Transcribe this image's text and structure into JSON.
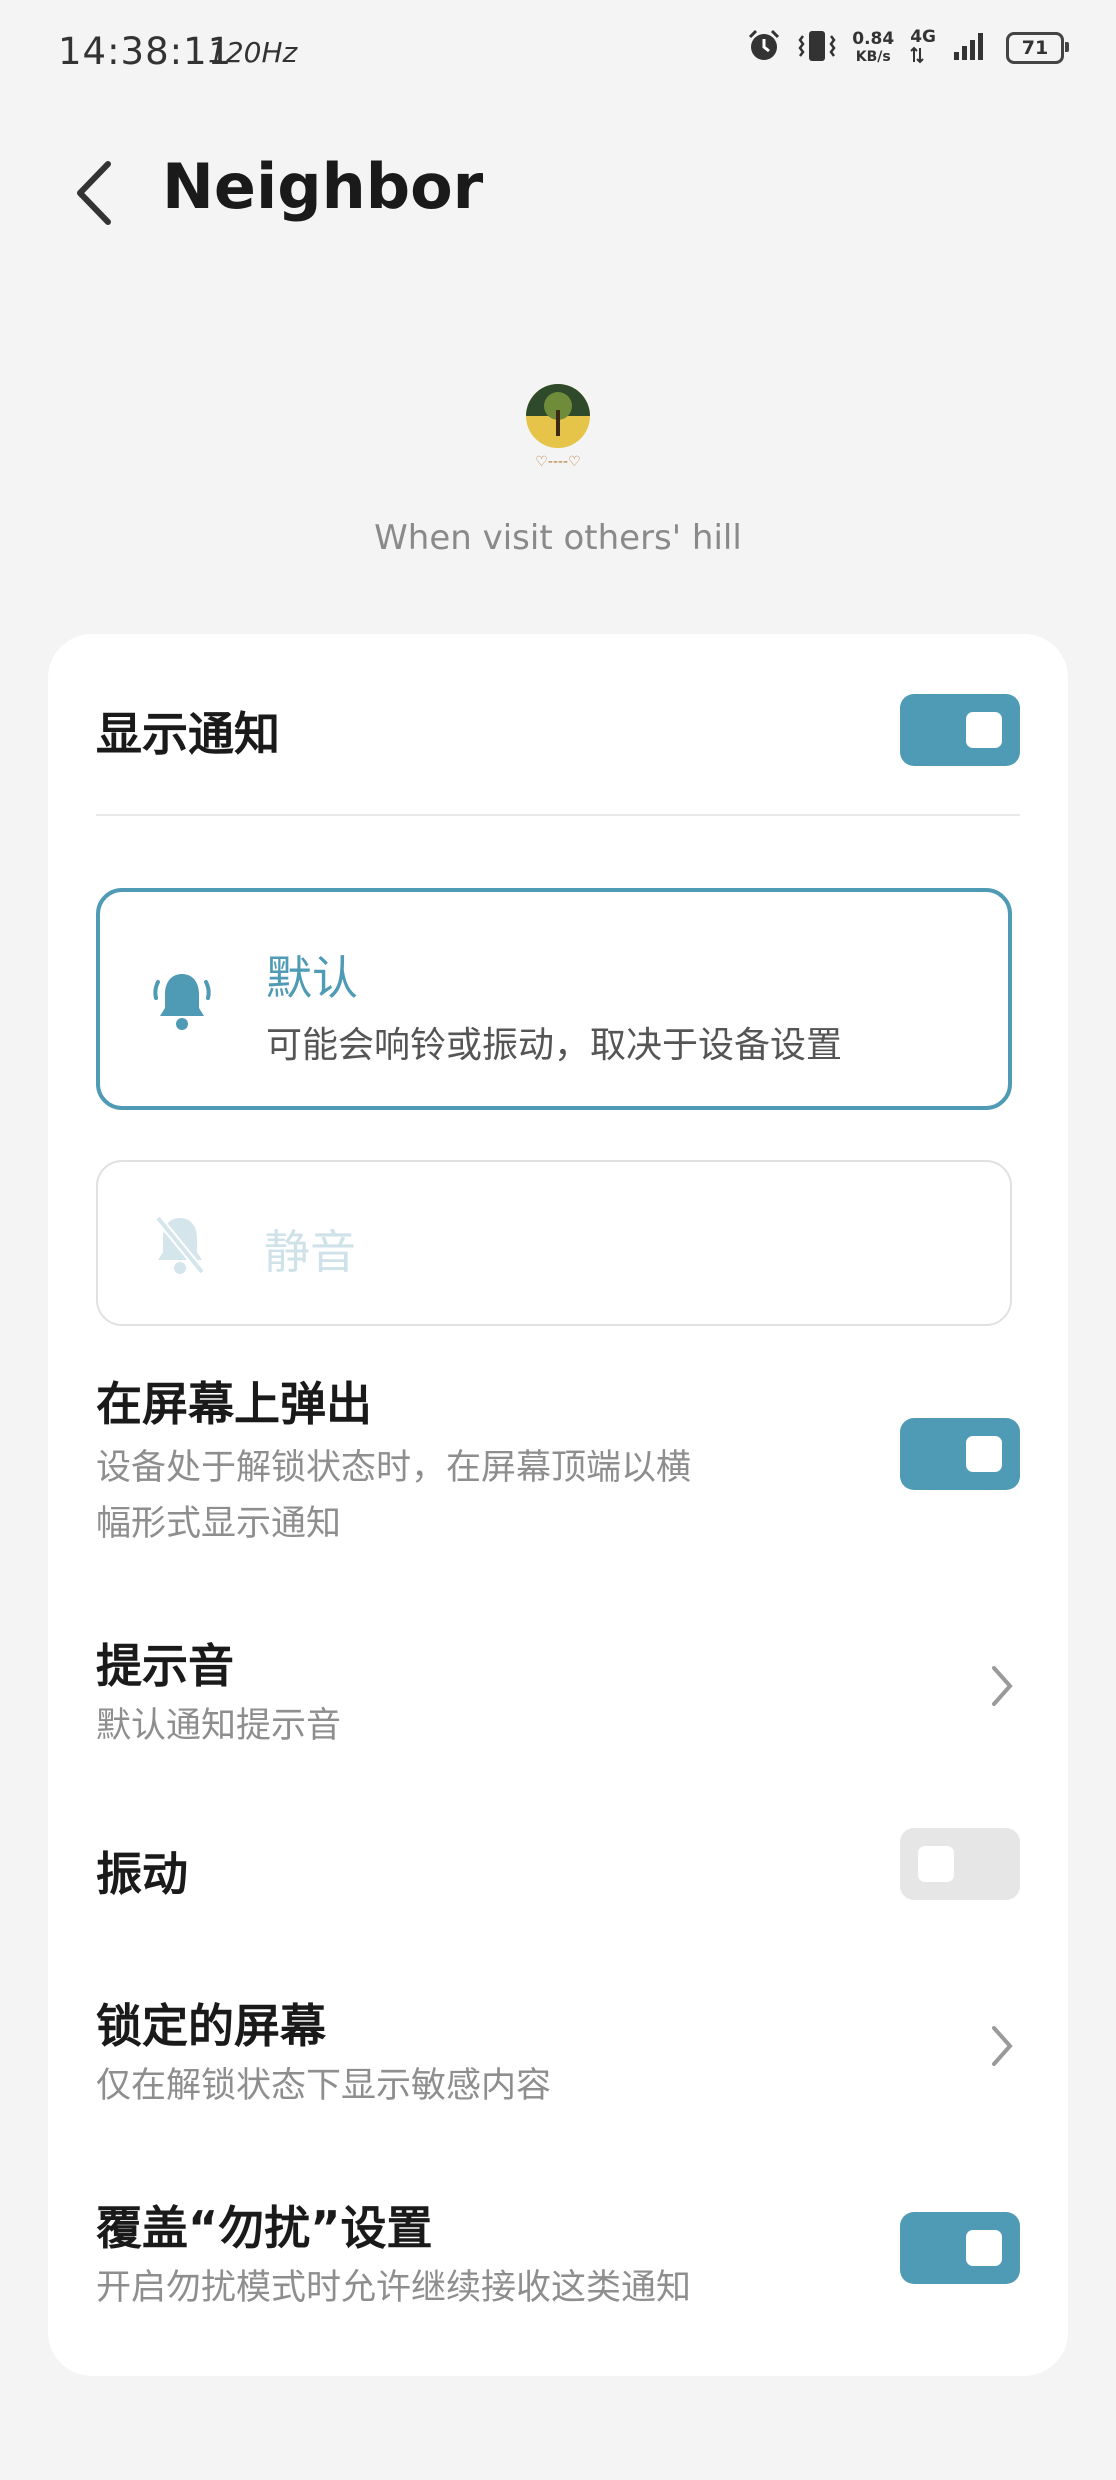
{
  "status_bar": {
    "time": "14:38:11",
    "refresh_rate": "120Hz",
    "net_speed_value": "0.84",
    "net_speed_unit": "KB/s",
    "network": "4G",
    "battery": "71"
  },
  "header": {
    "title": "Neighbor"
  },
  "app": {
    "name": "When visit others' hill"
  },
  "show_notification": {
    "label": "显示通知",
    "enabled": true
  },
  "modes": {
    "default": {
      "title": "默认",
      "subtitle": "可能会响铃或振动，取决于设备设置",
      "selected": true
    },
    "silent": {
      "title": "静音",
      "selected": false
    }
  },
  "popup": {
    "title": "在屏幕上弹出",
    "subtitle_line1": "设备处于解锁状态时，在屏幕顶端以横",
    "subtitle_line2": "幅形式显示通知",
    "enabled": true
  },
  "sound": {
    "title": "提示音",
    "subtitle": "默认通知提示音"
  },
  "vibration": {
    "title": "振动",
    "enabled": false
  },
  "lock_screen": {
    "title": "锁定的屏幕",
    "subtitle": "仅在解锁状态下显示敏感内容"
  },
  "dnd_override": {
    "title": "覆盖“勿扰”设置",
    "subtitle": "开启勿扰模式时允许继续接收这类通知",
    "enabled": true
  },
  "colors": {
    "accent": "#4f9ab5",
    "background": "#f4f4f4",
    "card": "#ffffff",
    "muted": "#d4e6ec"
  },
  "icons": {
    "back": "back-arrow-icon",
    "bell": "bell-icon",
    "bell_off": "bell-off-icon",
    "chevron": "chevron-right-icon",
    "alarm": "alarm-icon",
    "vibrate": "vibrate-icon",
    "signal": "signal-icon",
    "battery": "battery-icon"
  }
}
